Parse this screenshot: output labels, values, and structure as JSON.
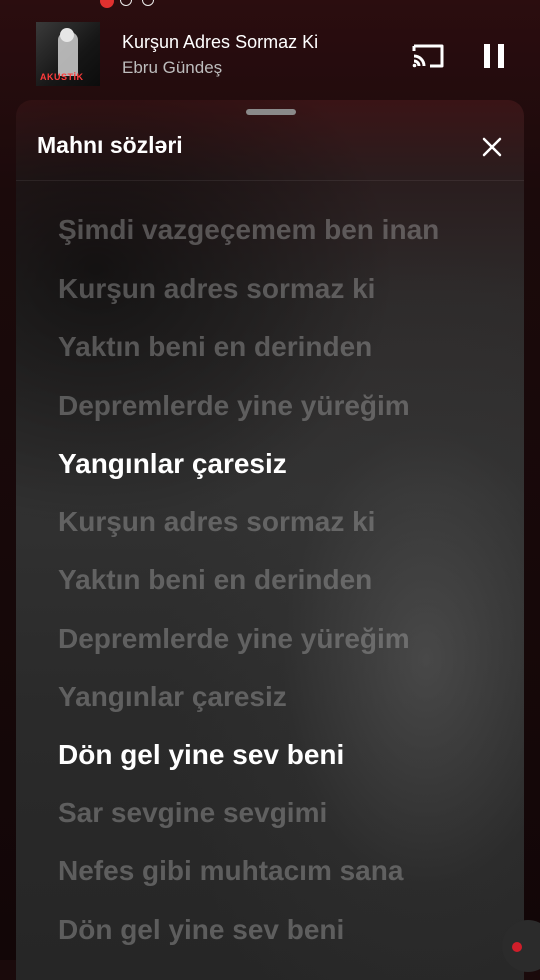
{
  "player": {
    "title": "Kurşun Adres Sormaz Ki",
    "artist": "Ebru Gündeş",
    "cover_text": "AKUSTİK"
  },
  "sheet": {
    "title": "Mahnı sözləri"
  },
  "lyrics": [
    {
      "text": "Şimdi vazgeçemem ben inan",
      "active": false
    },
    {
      "text": "Kurşun adres sormaz ki",
      "active": false
    },
    {
      "text": "Yaktın beni en derinden",
      "active": false
    },
    {
      "text": "Depremlerde yine yüreğim",
      "active": false
    },
    {
      "text": "Yangınlar çaresiz",
      "active": true
    },
    {
      "text": "Kurşun adres sormaz ki",
      "active": false
    },
    {
      "text": "Yaktın beni en derinden",
      "active": false
    },
    {
      "text": "Depremlerde yine yüreğim",
      "active": false
    },
    {
      "text": "Yangınlar çaresiz",
      "active": false
    },
    {
      "text": "Dön gel yine sev beni",
      "active": true
    },
    {
      "text": "Sar sevgine sevgimi",
      "active": false
    },
    {
      "text": "Nefes gibi muhtacım sana",
      "active": false
    },
    {
      "text": "Dön gel yine sev beni",
      "active": false
    }
  ],
  "icons": {
    "cast": "cast-icon",
    "pause": "pause-icon",
    "close": "close-icon"
  },
  "colors": {
    "accent_red": "#d01e2a",
    "active_lyric": "#ffffff"
  }
}
